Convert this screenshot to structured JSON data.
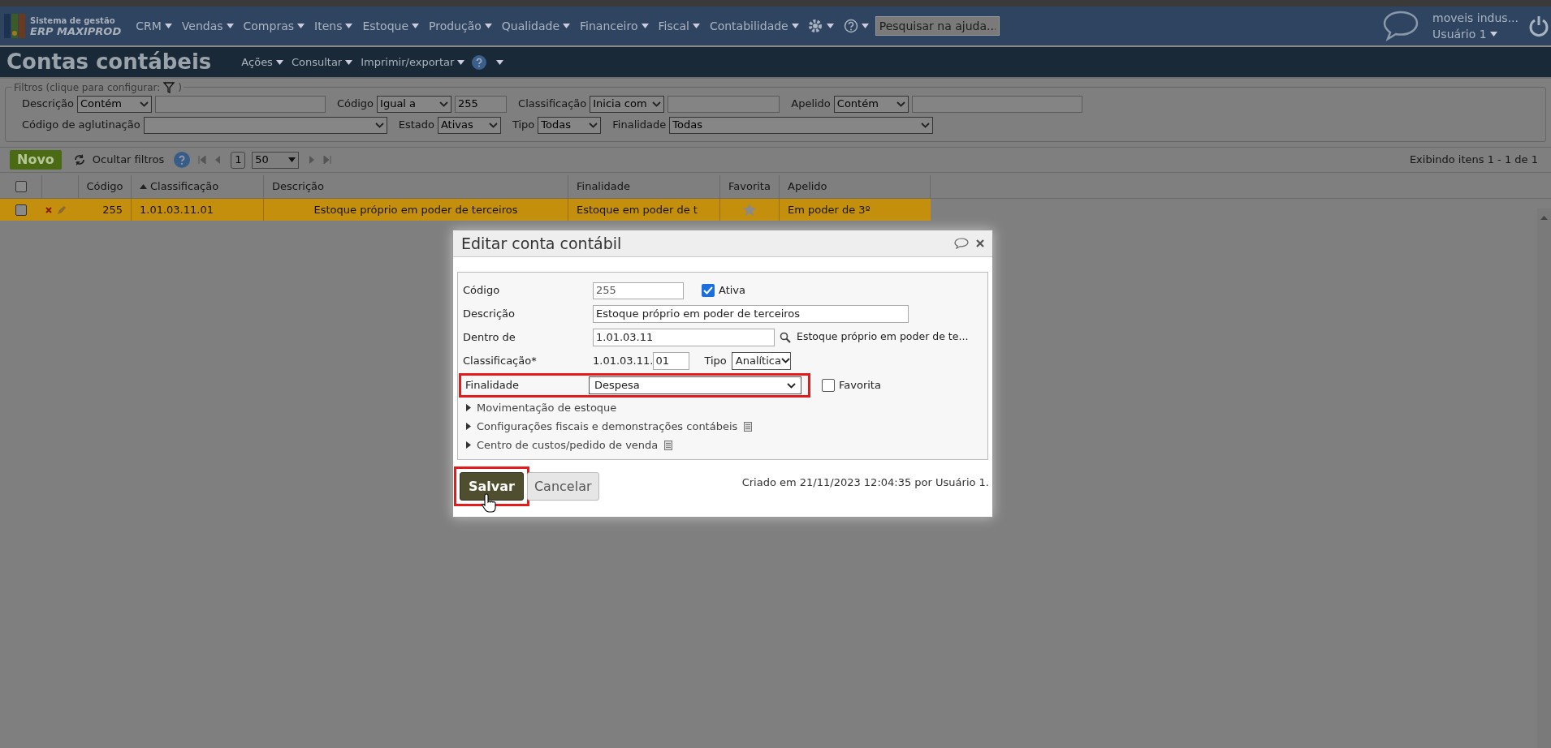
{
  "app": {
    "logo_line1": "Sistema de gestão",
    "logo_line2": "ERP MAXIPROD"
  },
  "menu": [
    "CRM",
    "Vendas",
    "Compras",
    "Itens",
    "Estoque",
    "Produção",
    "Qualidade",
    "Financeiro",
    "Fiscal",
    "Contabilidade"
  ],
  "help_search": {
    "placeholder": "Pesquisar na ajuda..."
  },
  "account": {
    "company": "moveis indus...",
    "user": "Usuário 1"
  },
  "page": {
    "title": "Contas contábeis",
    "actions": [
      "Ações",
      "Consultar",
      "Imprimir/exportar"
    ]
  },
  "filters": {
    "legend": "Filtros (clique para configurar:",
    "legend_end": ")",
    "rows": [
      [
        {
          "kind": "operator",
          "label": "Descrição",
          "operator": "Contém"
        },
        {
          "kind": "operator",
          "label": "Código",
          "operator": "Igual a",
          "value": "255"
        },
        {
          "kind": "operator",
          "label": "Classificação",
          "operator": "Inicia com"
        },
        {
          "kind": "operator",
          "label": "Apelido",
          "operator": "Contém"
        }
      ],
      [
        {
          "kind": "select",
          "label": "Código de aglutinação"
        },
        {
          "kind": "select",
          "label": "Estado",
          "value": "Ativas"
        },
        {
          "kind": "select",
          "label": "Tipo",
          "value": "Todas"
        },
        {
          "kind": "select",
          "label": "Finalidade",
          "value": "Todas"
        }
      ]
    ]
  },
  "toolbar": {
    "new_button": "Novo",
    "hide_filters": "Ocultar filtros",
    "page": "1",
    "page_size": "50",
    "showing": "Exibindo itens 1 - 1 de 1"
  },
  "table": {
    "all_checked": false,
    "columns": [
      {
        "label": "Código",
        "sorted": false
      },
      {
        "label": "Classificação",
        "sorted": true
      },
      {
        "label": "Descrição",
        "sorted": false
      },
      {
        "label": "Finalidade",
        "sorted": false
      },
      {
        "label": "Favorita",
        "sorted": false
      },
      {
        "label": "Apelido",
        "sorted": false
      }
    ],
    "rows": [
      {
        "selected": true,
        "checked": false,
        "cells": [
          "255",
          "1.01.03.11.01",
          "Estoque próprio em poder de terceiros",
          "Estoque em poder de t"
        ],
        "favorite": false,
        "apelido": "Em poder de 3º"
      }
    ]
  },
  "dialog": {
    "title": "Editar conta contábil",
    "codigo": {
      "label": "Código",
      "value": "255"
    },
    "ativa": {
      "label": "Ativa",
      "checked": true
    },
    "descricao": {
      "label": "Descrição",
      "value": "Estoque próprio em poder de terceiros"
    },
    "dentro_de": {
      "label": "Dentro de",
      "value": "1.01.03.11",
      "lookup_text": "Estoque próprio em poder de te..."
    },
    "classificacao": {
      "label": "Classificação*",
      "prefix": "1.01.03.11.",
      "value": "01"
    },
    "tipo": {
      "label": "Tipo",
      "value": "Analítica"
    },
    "finalidade": {
      "label": "Finalidade",
      "value": "Despesa",
      "highlighted": true
    },
    "favorita": {
      "label": "Favorita",
      "checked": false
    },
    "sections": [
      {
        "label": "Movimentação de estoque",
        "doc_icon": false
      },
      {
        "label": "Configurações fiscais e demonstrações contábeis",
        "doc_icon": true
      },
      {
        "label": "Centro de custos/pedido de venda",
        "doc_icon": true
      }
    ],
    "save_button": {
      "label": "Salvar",
      "highlighted": true
    },
    "cancel_button": {
      "label": "Cancelar"
    },
    "created": "Criado em 21/11/2023 12:04:35 por Usuário 1."
  }
}
